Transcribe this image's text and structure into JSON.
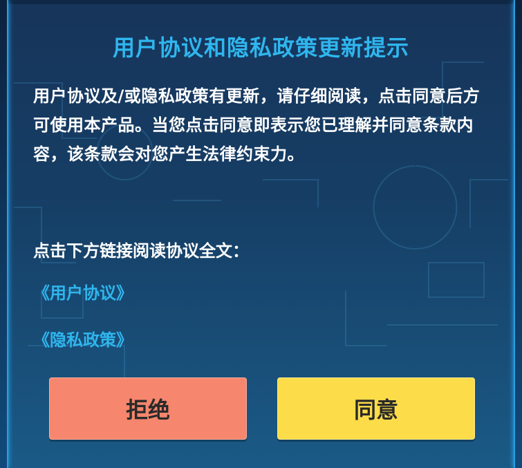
{
  "dialog": {
    "title": "用户协议和隐私政策更新提示",
    "body": "用户协议及/或隐私政策有更新，请仔细阅读，点击同意后方可使用本产品。当您点击同意即表示您已理解并同意条款内容，该条款会对您产生法律约束力。",
    "prompt": "点击下方链接阅读协议全文：",
    "links": {
      "user_agreement": "《用户协议》",
      "privacy_policy": "《隐私政策》"
    },
    "buttons": {
      "reject": "拒绝",
      "agree": "同意"
    }
  },
  "colors": {
    "accent": "#2fb6ee",
    "reject": "#f6866d",
    "agree": "#fcdc49",
    "background": "#163f66"
  }
}
